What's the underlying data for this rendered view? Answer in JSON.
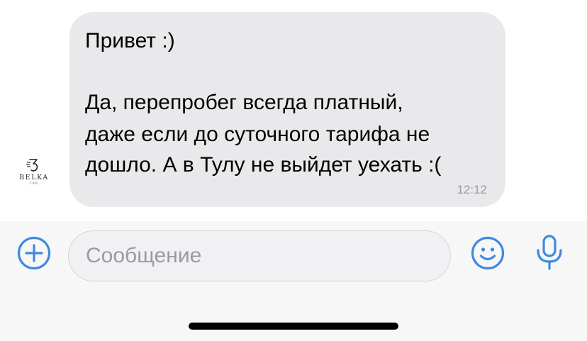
{
  "colors": {
    "accent": "#3f8ae0",
    "bubble": "#e9e9eb",
    "timestamp": "#9a9aa0",
    "input_bar": "#f7f7f8"
  },
  "avatar": {
    "brand": "BELKA",
    "brand_sub": "CAR"
  },
  "message": {
    "lines": [
      "Привет :)",
      "",
      "Да, перепробег всегда платный,",
      "даже если до суточного тарифа не",
      "дошло. А в Тулу не выйдет уехать :("
    ],
    "time": "12:12"
  },
  "composer": {
    "placeholder": "Сообщение",
    "value": "",
    "icons": {
      "attach": "plus-circle-icon",
      "emoji": "smile-icon",
      "voice": "microphone-icon"
    }
  }
}
